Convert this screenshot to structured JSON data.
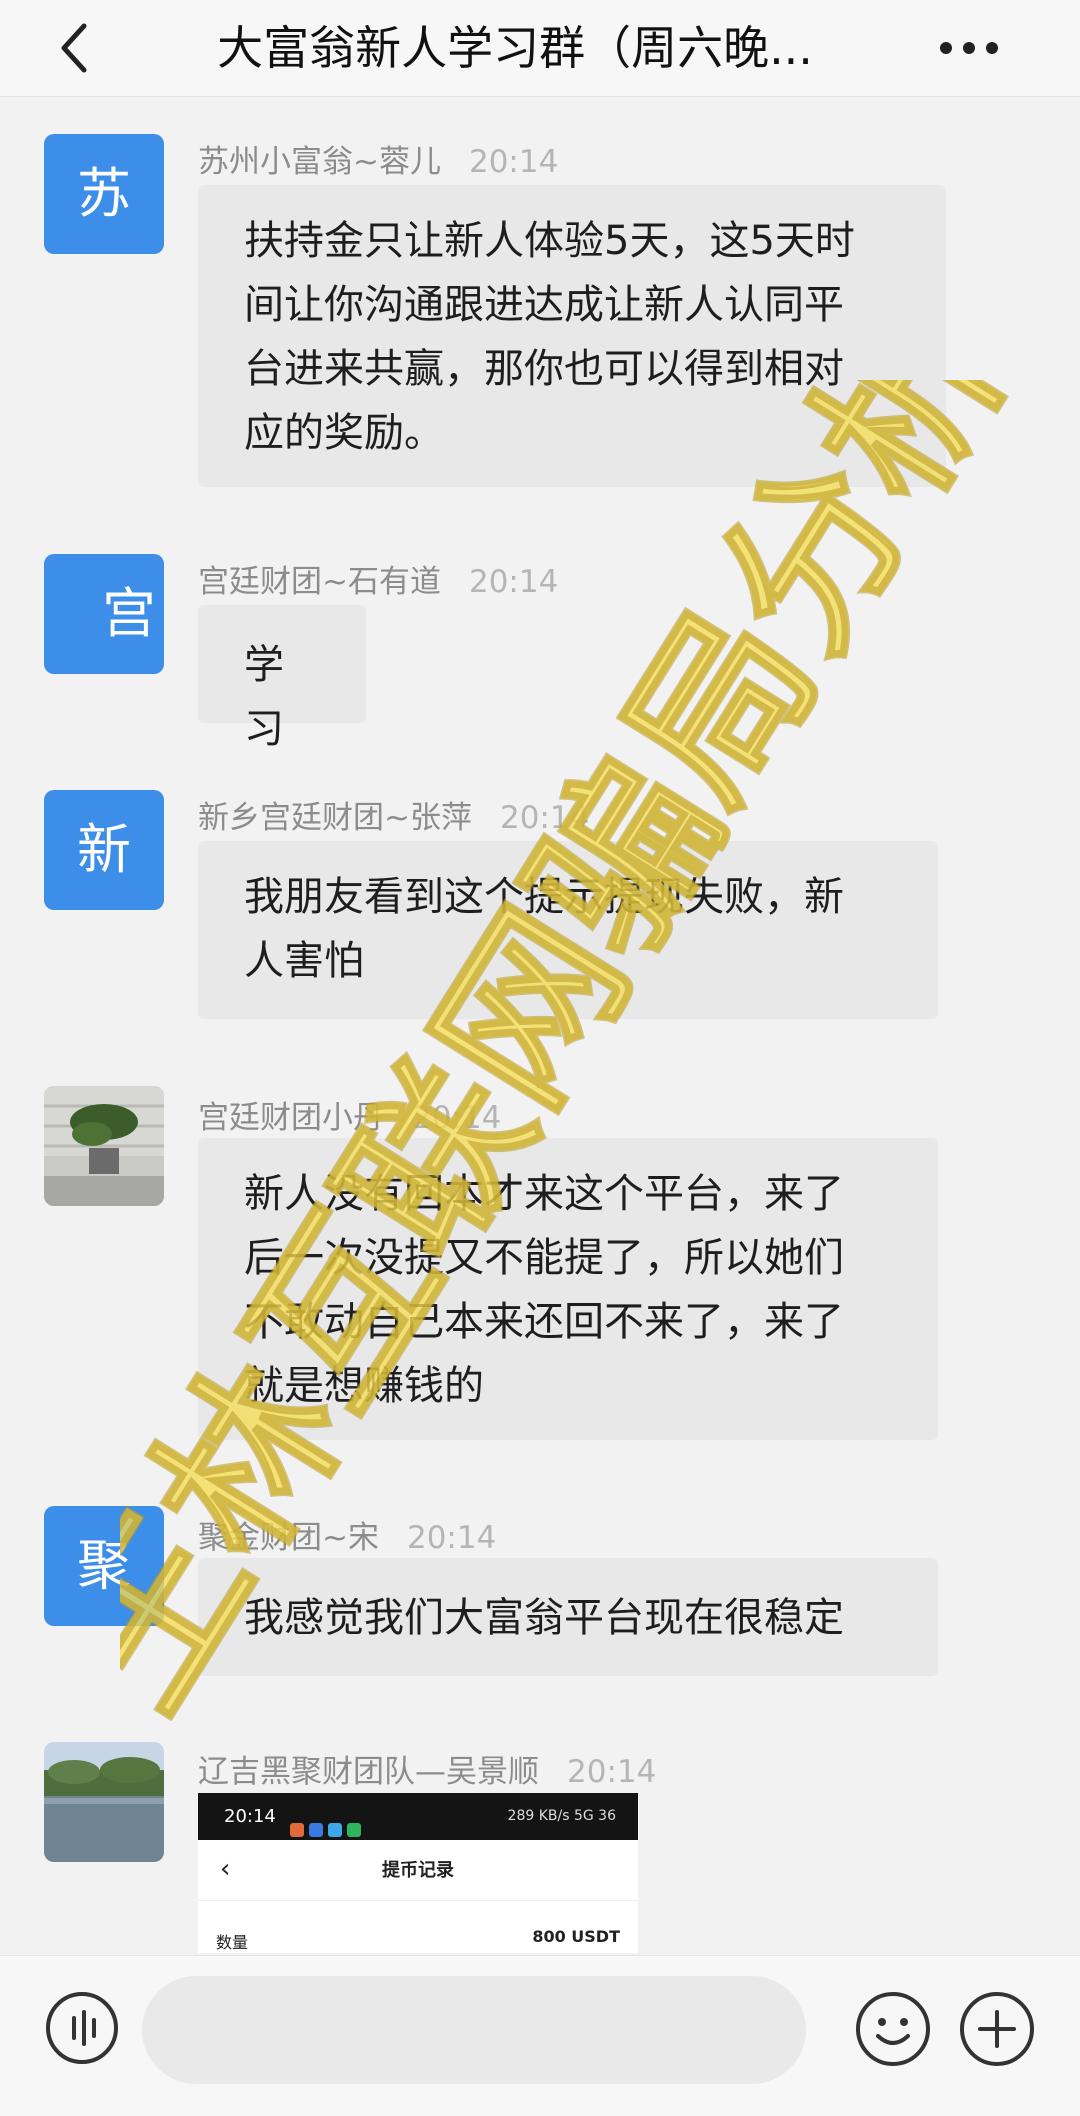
{
  "header": {
    "title": "大富翁新人学习群（周六晚..."
  },
  "messages": [
    {
      "avatar_text": "苏",
      "sender": "苏州小富翁~蓉儿",
      "time": "20:14",
      "lines": [
        "扶持金只让新人体验5天，这5天时",
        "间让你沟通跟进达成让新人认同平",
        "台进来共赢，那你也可以得到相对",
        "应的奖励。"
      ]
    },
    {
      "avatar_text": "宫",
      "sender": "宫廷财团~石有道",
      "time": "20:14",
      "lines": [
        "学习"
      ]
    },
    {
      "avatar_text": "新",
      "sender": "新乡宫廷财团~张萍",
      "time": "20:14",
      "lines": [
        "我朋友看到这个提示提现失败，新",
        "人害怕"
      ]
    },
    {
      "avatar_text": "",
      "sender": "宫廷财团小丹",
      "time": "20:14",
      "lines": [
        "新人没有回本才来这个平台，来了",
        "后一次没提又不能提了，所以她们",
        "不敢动自己本来还回不来了，来了",
        "就是想赚钱的"
      ]
    },
    {
      "avatar_text": "聚",
      "sender": "聚金财团~宋",
      "time": "20:14",
      "lines": [
        "我感觉我们大富翁平台现在很稳定"
      ]
    },
    {
      "avatar_text": "",
      "sender": "辽吉黑聚财团队—吴景顺",
      "time": "20:14",
      "lines": []
    }
  ],
  "embedded_screenshot": {
    "status_time": "20:14",
    "status_right": "289 KB/s 5G 36",
    "back": "‹",
    "title": "提币记录",
    "row_label": "数量",
    "row_value": "800 USDT"
  },
  "watermark": {
    "text": "王林互联网骗局分析",
    "color": "#f5dd55"
  },
  "colors": {
    "avatar_blue": "#3d8ee9",
    "bubble": "#e8e8e8"
  },
  "icons": [
    "back-icon",
    "more-icon",
    "voice-icon",
    "emoji-icon",
    "plus-icon"
  ]
}
